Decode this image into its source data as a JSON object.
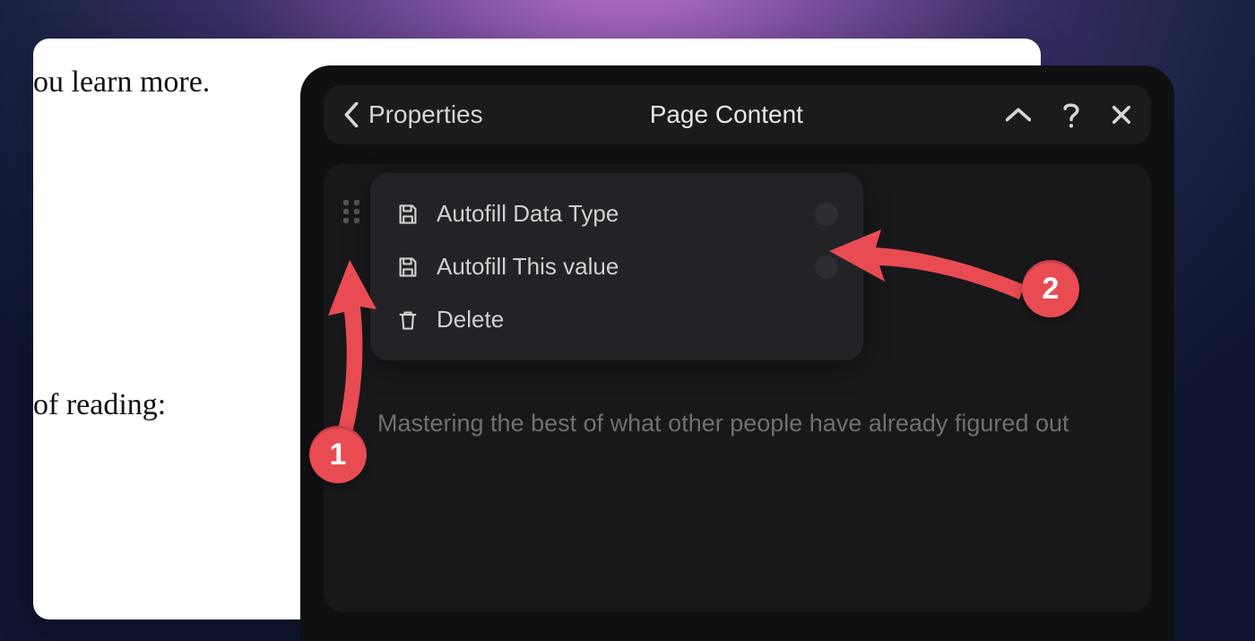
{
  "background_document": {
    "line1": "ou learn more.",
    "line2": " of reading:"
  },
  "panel": {
    "header": {
      "back_label": "Properties",
      "title": "Page Content"
    },
    "menu": {
      "items": [
        {
          "icon": "save",
          "label": "Autofill Data Type",
          "has_indicator": true
        },
        {
          "icon": "save",
          "label": "Autofill This value",
          "has_indicator": true
        },
        {
          "icon": "trash",
          "label": "Delete",
          "has_indicator": false
        }
      ]
    },
    "body_text": "Mastering the best of what other people have already figured out"
  },
  "annotations": {
    "badge1": "1",
    "badge2": "2"
  }
}
